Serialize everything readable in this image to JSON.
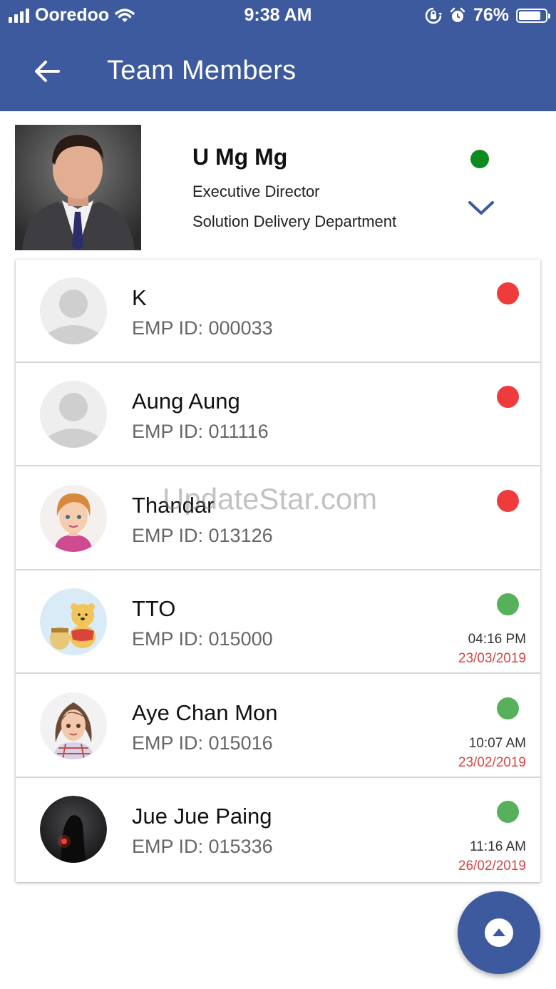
{
  "status_bar": {
    "carrier": "Ooredoo",
    "time": "9:38 AM",
    "battery": "76%",
    "icons": [
      "signal-icon",
      "wifi-icon",
      "rotation-lock-icon",
      "alarm-icon",
      "battery-icon"
    ]
  },
  "header": {
    "title": "Team Members",
    "back_icon": "arrow-left-icon",
    "background": "#3d5a9e"
  },
  "profile": {
    "name": "U Mg Mg",
    "role": "Executive Director",
    "department": "Solution Delivery Department",
    "status_color": "#0e8a1e",
    "expand_icon": "chevron-down-icon"
  },
  "members": [
    {
      "name": "K",
      "emp": "EMP ID: 000033",
      "status_color": "#ef3b3b",
      "time": "",
      "date": "",
      "avatar": "placeholder"
    },
    {
      "name": "Aung Aung",
      "emp": "EMP ID: 011116",
      "status_color": "#ef3b3b",
      "time": "",
      "date": "",
      "avatar": "placeholder"
    },
    {
      "name": "Thandar",
      "emp": "EMP ID: 013126",
      "status_color": "#ef3b3b",
      "time": "",
      "date": "",
      "avatar": "cartoon-woman"
    },
    {
      "name": "TTO",
      "emp": "EMP ID: 015000",
      "status_color": "#57b05a",
      "time": "04:16 PM",
      "date": "23/03/2019",
      "avatar": "bear"
    },
    {
      "name": "Aye Chan Mon",
      "emp": "EMP ID: 015016",
      "status_color": "#57b05a",
      "time": "10:07 AM",
      "date": "23/02/2019",
      "avatar": "cartoon-girl"
    },
    {
      "name": "Jue Jue Paing",
      "emp": "EMP ID: 015336",
      "status_color": "#57b05a",
      "time": "11:16 AM",
      "date": "26/02/2019",
      "avatar": "dark-figure"
    }
  ],
  "watermark": "UpdateStar.com",
  "fab": {
    "icon": "triangle-up-icon"
  }
}
